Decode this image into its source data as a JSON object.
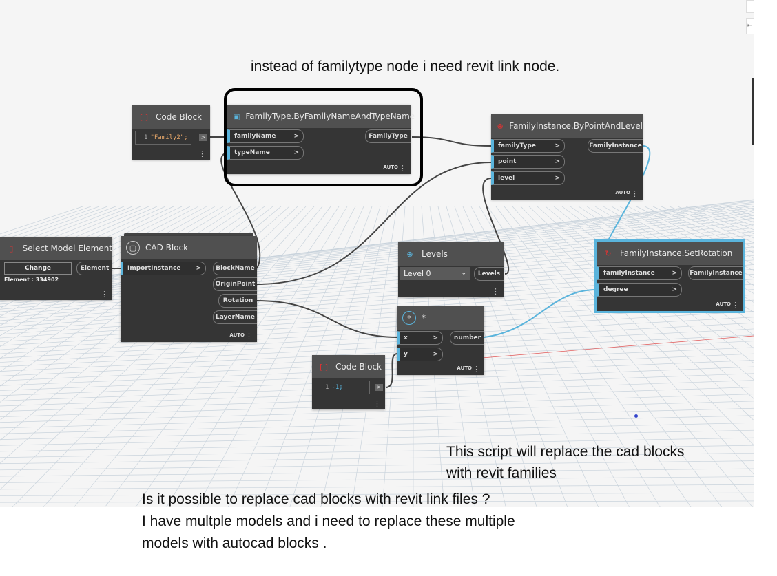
{
  "annotations": {
    "top": "instead of familytype node i need revit link node.",
    "right_line1": "This script will replace the cad blocks",
    "right_line2": "with revit families",
    "bottom_line1": "Is it possible to replace cad blocks with revit link files ?",
    "bottom_line2": "I have multple models and i need to replace these multiple",
    "bottom_line3": "models with autocad blocks ."
  },
  "nodes": {
    "code_block_1": {
      "title": "Code Block",
      "line": "1",
      "code": "\"Family2\";",
      "run": ">"
    },
    "family_type": {
      "title": "FamilyType.ByFamilyNameAndTypeName",
      "inputs": [
        "familyName",
        "typeName"
      ],
      "output": "FamilyType",
      "mode": "AUTO"
    },
    "by_point_level": {
      "title": "FamilyInstance.ByPointAndLevel",
      "inputs": [
        "familyType",
        "point",
        "level"
      ],
      "output": "FamilyInstance",
      "mode": "AUTO"
    },
    "select_model": {
      "title": "Select Model Element",
      "button": "Change",
      "info": "Element : 334902",
      "output": "Element"
    },
    "cad_block": {
      "title": "CAD Block",
      "inputs": [
        "ImportInstance"
      ],
      "outputs": [
        "BlockName",
        "OriginPoint",
        "Rotation",
        "LayerName"
      ],
      "mode": "AUTO"
    },
    "levels": {
      "title": "Levels",
      "selected": "Level 0",
      "output": "Levels"
    },
    "set_rotation": {
      "title": "FamilyInstance.SetRotation",
      "inputs": [
        "familyInstance",
        "degree"
      ],
      "output": "FamilyInstance",
      "mode": "AUTO"
    },
    "multiply": {
      "title": "*",
      "inputs": [
        "x",
        "y"
      ],
      "output": "number",
      "mode": "AUTO"
    },
    "code_block_2": {
      "title": "Code Block",
      "line": "1",
      "code": "-1;",
      "run": ">"
    }
  },
  "colors": {
    "node_body": "#353535",
    "node_header": "#505050",
    "selected": "#5ab4dc",
    "port_accent": "#5ab4dc"
  }
}
